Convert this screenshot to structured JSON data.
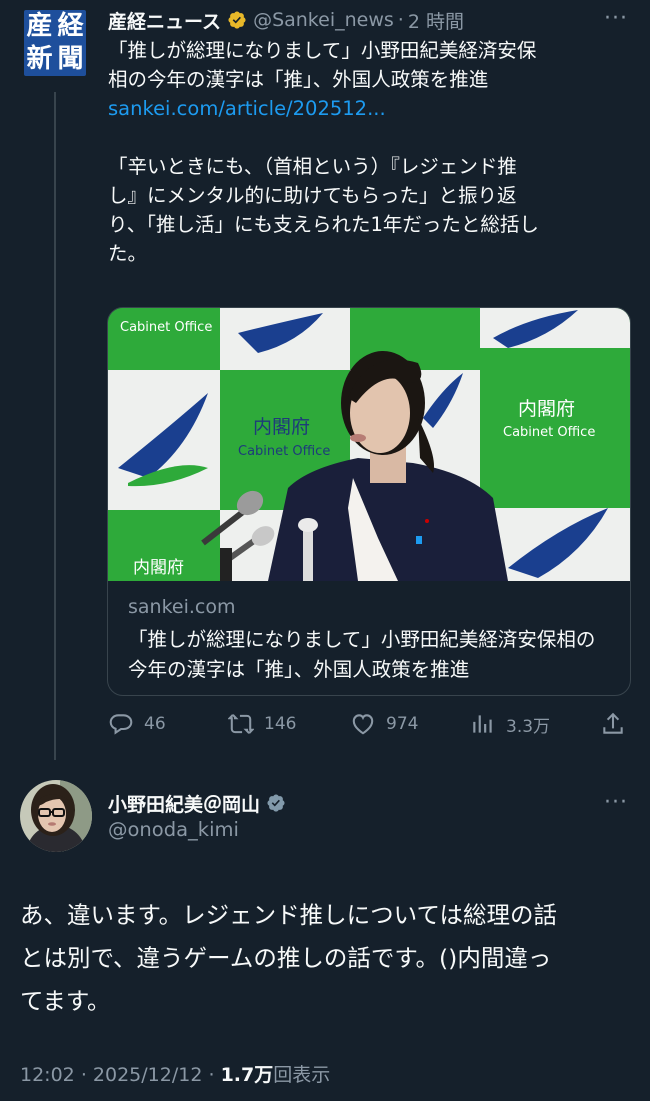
{
  "tweet": {
    "avatar_chars": [
      "産",
      "経",
      "新",
      "聞"
    ],
    "display_name": "産経ニュース",
    "handle": "@Sankei_news",
    "separator": "·",
    "time": "2 時間",
    "more": "···",
    "text_lines": [
      "「推しが総理になりまして」小野田紀美経済安保",
      "相の今年の漢字は「推」、外国人政策を推進"
    ],
    "link": "sankei.com/article/202512...",
    "text_body": "「辛いときにも、（首相という）『レジェンド推\nし』にメンタル的に助けてもらった」と振り返\nり、「推し活」にも支えられた1年だったと総括し\nた。",
    "card": {
      "image_text": {
        "jp": "内閣府",
        "en": "Cabinet Office"
      },
      "domain": "sankei.com",
      "title": "「推しが総理になりまして」小野田紀美経済安保相の今年の漢字は「推」、外国人政策を推進"
    },
    "actions": {
      "replies": "46",
      "reposts": "146",
      "likes": "974",
      "views": "3.3万"
    }
  },
  "reply": {
    "display_name": "小野田紀美＠岡山",
    "handle": "@onoda_kimi",
    "more": "···",
    "text": "あ、違います。レジェンド推しについては総理の話\nとは別で、違うゲームの推しの話です。()内間違っ\nてます。",
    "time": "12:02",
    "dot": "·",
    "date": "2025/12/12",
    "views_count": "1.7万",
    "views_label": "回表示"
  },
  "colors": {
    "background": "#15202b",
    "link": "#1d9bf0",
    "verified_gold": "#e8b829",
    "verified_gray": "#829aab",
    "muted": "#8b98a5"
  }
}
